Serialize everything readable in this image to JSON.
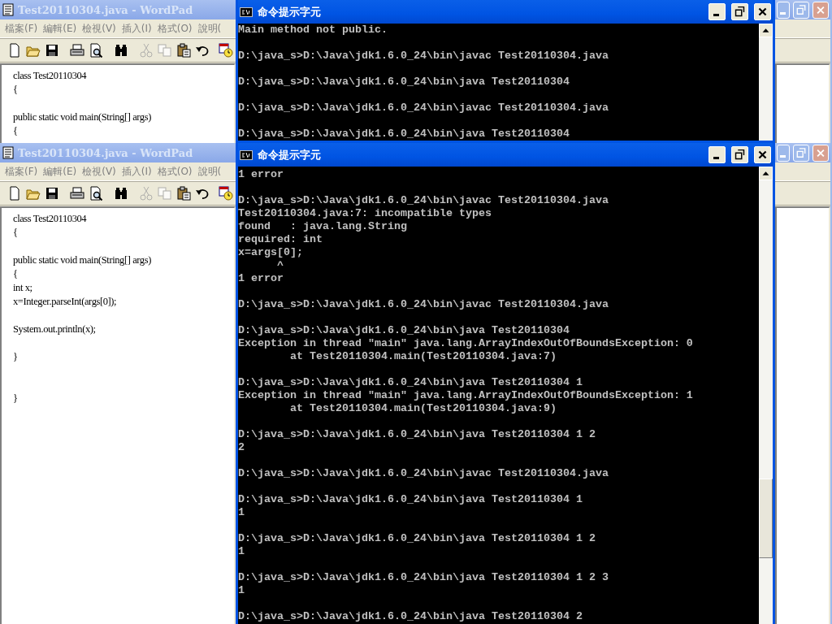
{
  "wordpad_windows": [
    {
      "title": "Test20110304.java - WordPad",
      "menu": [
        "檔案(F)",
        "編輯(E)",
        "檢視(V)",
        "插入(I)",
        "格式(O)",
        "說明("
      ],
      "toolbar": [
        {
          "kind": "new",
          "disabled": false
        },
        {
          "kind": "open",
          "disabled": false
        },
        {
          "kind": "save",
          "disabled": false
        },
        {
          "kind": "print",
          "disabled": false
        },
        {
          "kind": "preview",
          "disabled": false
        },
        {
          "kind": "find",
          "disabled": false
        },
        {
          "kind": "cut",
          "disabled": true
        },
        {
          "kind": "copy",
          "disabled": true
        },
        {
          "kind": "paste",
          "disabled": false
        },
        {
          "kind": "undo",
          "disabled": false
        },
        {
          "kind": "datetime",
          "disabled": false
        }
      ],
      "document": "class Test20110304\n{\n\npublic static void main(String[] args)\n{"
    },
    {
      "title": "Test20110304.java - WordPad",
      "menu": [
        "檔案(F)",
        "編輯(E)",
        "檢視(V)",
        "插入(I)",
        "格式(O)",
        "說明("
      ],
      "toolbar": [
        {
          "kind": "new",
          "disabled": false
        },
        {
          "kind": "open",
          "disabled": false
        },
        {
          "kind": "save",
          "disabled": false
        },
        {
          "kind": "print",
          "disabled": false
        },
        {
          "kind": "preview",
          "disabled": false
        },
        {
          "kind": "find",
          "disabled": false
        },
        {
          "kind": "cut",
          "disabled": true
        },
        {
          "kind": "copy",
          "disabled": true
        },
        {
          "kind": "paste",
          "disabled": false
        },
        {
          "kind": "undo",
          "disabled": false
        },
        {
          "kind": "datetime",
          "disabled": false
        }
      ],
      "document": "class Test20110304\n{\n\npublic static void main(String[] args)\n{\nint x;\nx=Integer.parseInt(args[0]);\n\nSystem.out.println(x);\n\n}\n\n\n}"
    }
  ],
  "console_windows": [
    {
      "title": "命令提示字元",
      "output": "Main method not public.\n\nD:\\java_s>D:\\Java\\jdk1.6.0_24\\bin\\javac Test20110304.java\n\nD:\\java_s>D:\\Java\\jdk1.6.0_24\\bin\\java Test20110304\n\nD:\\java_s>D:\\Java\\jdk1.6.0_24\\bin\\javac Test20110304.java\n\nD:\\java_s>D:\\Java\\jdk1.6.0_24\\bin\\java Test20110304"
    },
    {
      "title": "命令提示字元",
      "output": "1 error\n\nD:\\java_s>D:\\Java\\jdk1.6.0_24\\bin\\javac Test20110304.java\nTest20110304.java:7: incompatible types\nfound   : java.lang.String\nrequired: int\nx=args[0];\n      ^\n1 error\n\nD:\\java_s>D:\\Java\\jdk1.6.0_24\\bin\\javac Test20110304.java\n\nD:\\java_s>D:\\Java\\jdk1.6.0_24\\bin\\java Test20110304\nException in thread \"main\" java.lang.ArrayIndexOutOfBoundsException: 0\n        at Test20110304.main(Test20110304.java:7)\n\nD:\\java_s>D:\\Java\\jdk1.6.0_24\\bin\\java Test20110304 1\nException in thread \"main\" java.lang.ArrayIndexOutOfBoundsException: 1\n        at Test20110304.main(Test20110304.java:9)\n\nD:\\java_s>D:\\Java\\jdk1.6.0_24\\bin\\java Test20110304 1 2\n2\n\nD:\\java_s>D:\\Java\\jdk1.6.0_24\\bin\\javac Test20110304.java\n\nD:\\java_s>D:\\Java\\jdk1.6.0_24\\bin\\java Test20110304 1\n1\n\nD:\\java_s>D:\\Java\\jdk1.6.0_24\\bin\\java Test20110304 1 2\n1\n\nD:\\java_s>D:\\Java\\jdk1.6.0_24\\bin\\java Test20110304 1 2 3\n1\n\nD:\\java_s>D:\\Java\\jdk1.6.0_24\\bin\\java Test20110304 2"
    }
  ]
}
